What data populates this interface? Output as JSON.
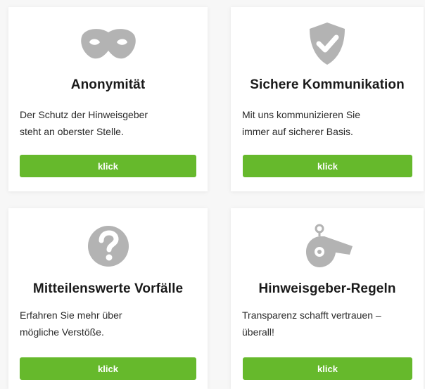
{
  "colors": {
    "accent_green": "#66b92c",
    "icon_gray": "#b3b3b3",
    "card_bg": "#ffffff",
    "page_bg": "#f7f7f7"
  },
  "cards": [
    {
      "icon": "mask-icon",
      "title": "Anonymität",
      "desc_lines": [
        "Der Schutz der Hinweisgeber",
        "steht an oberster Stelle."
      ],
      "button_label": "klick"
    },
    {
      "icon": "shield-check-icon",
      "title": "Sichere Kommunikation",
      "desc_lines": [
        "Mit uns kommunizieren Sie",
        "immer auf sicherer Basis."
      ],
      "button_label": "klick"
    },
    {
      "icon": "question-circle-icon",
      "title": "Mitteilenswerte Vorfälle",
      "desc_lines": [
        "Erfahren Sie mehr über",
        "mögliche Verstöße."
      ],
      "button_label": "klick"
    },
    {
      "icon": "whistle-icon",
      "title": "Hinweisgeber-Regeln",
      "desc_lines": [
        "Transparenz schafft vertrauen –",
        "überall!"
      ],
      "button_label": "klick"
    }
  ]
}
